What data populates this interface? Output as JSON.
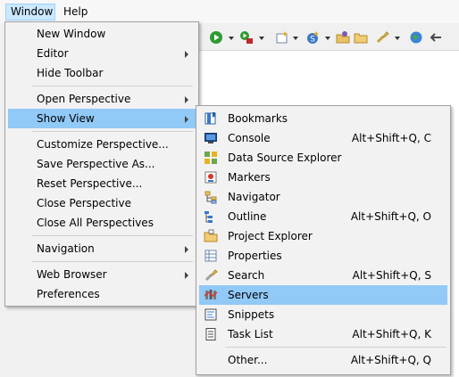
{
  "menubar": {
    "window": "Window",
    "help": "Help"
  },
  "window_menu": {
    "new_window": "New Window",
    "editor": "Editor",
    "hide_toolbar": "Hide Toolbar",
    "open_perspective": "Open Perspective",
    "show_view": "Show View",
    "customize_perspective": "Customize Perspective...",
    "save_perspective_as": "Save Perspective As...",
    "reset_perspective": "Reset Perspective...",
    "close_perspective": "Close Perspective",
    "close_all_perspectives": "Close All Perspectives",
    "navigation": "Navigation",
    "web_browser": "Web Browser",
    "preferences": "Preferences"
  },
  "show_view_menu": {
    "items": [
      {
        "label": "Bookmarks",
        "shortcut": "",
        "icon": "bookmarks-icon"
      },
      {
        "label": "Console",
        "shortcut": "Alt+Shift+Q, C",
        "icon": "console-icon"
      },
      {
        "label": "Data Source Explorer",
        "shortcut": "",
        "icon": "data-source-explorer-icon"
      },
      {
        "label": "Markers",
        "shortcut": "",
        "icon": "markers-icon"
      },
      {
        "label": "Navigator",
        "shortcut": "",
        "icon": "navigator-icon"
      },
      {
        "label": "Outline",
        "shortcut": "Alt+Shift+Q, O",
        "icon": "outline-icon"
      },
      {
        "label": "Project Explorer",
        "shortcut": "",
        "icon": "project-explorer-icon"
      },
      {
        "label": "Properties",
        "shortcut": "",
        "icon": "properties-icon"
      },
      {
        "label": "Search",
        "shortcut": "Alt+Shift+Q, S",
        "icon": "search-icon"
      },
      {
        "label": "Servers",
        "shortcut": "",
        "icon": "servers-icon"
      },
      {
        "label": "Snippets",
        "shortcut": "",
        "icon": "snippets-icon"
      },
      {
        "label": "Task List",
        "shortcut": "Alt+Shift+Q, K",
        "icon": "task-list-icon"
      }
    ],
    "other": {
      "label": "Other...",
      "shortcut": "Alt+Shift+Q, Q"
    },
    "selected": "Servers"
  },
  "colors": {
    "highlight": "#91c9f7",
    "menu_bg": "#f2f2f2",
    "menubar_active": "#cce8ff"
  }
}
